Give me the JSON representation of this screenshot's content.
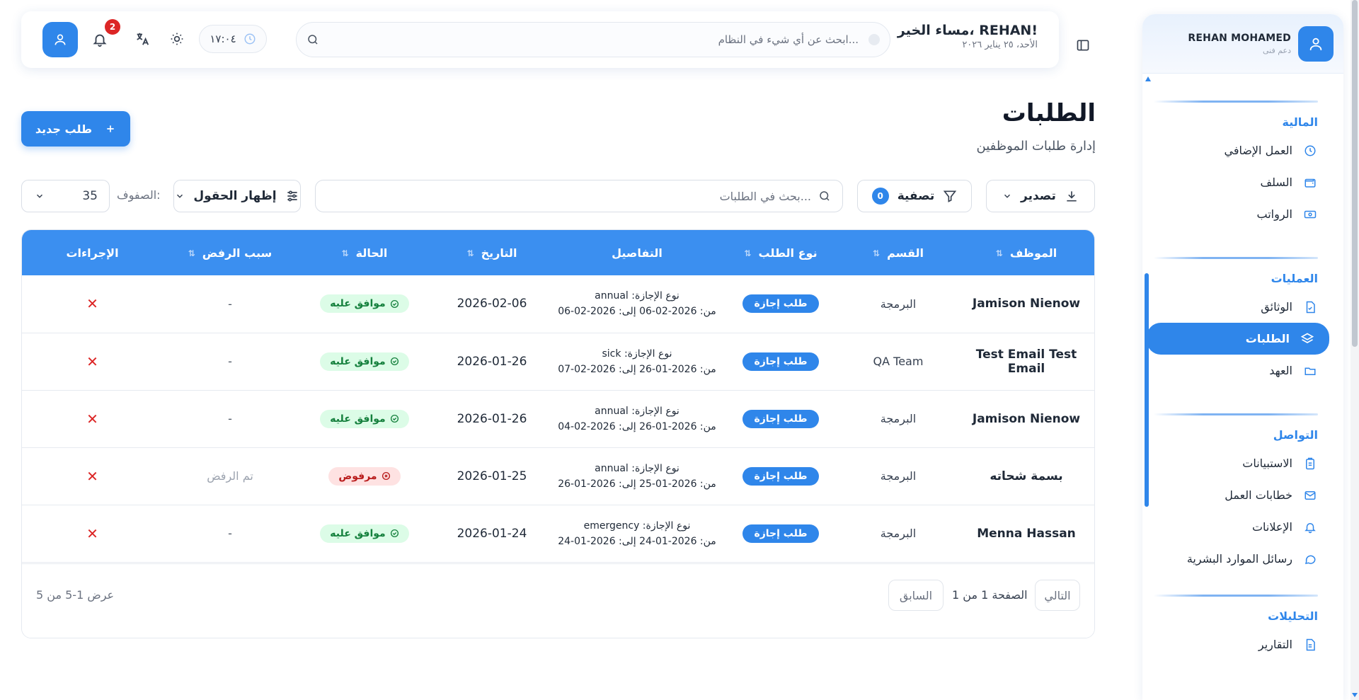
{
  "sidebar": {
    "user_name": "REHAN MOHAMED",
    "user_role": "دعم فنى",
    "sections": [
      {
        "title": "المالية",
        "items": [
          {
            "label": "العمل الإضافي",
            "icon": "clock-icon"
          },
          {
            "label": "السلف",
            "icon": "wallet-icon"
          },
          {
            "label": "الرواتب",
            "icon": "banknote-icon"
          }
        ]
      },
      {
        "title": "العمليات",
        "items": [
          {
            "label": "الوثائق",
            "icon": "file-check-icon"
          },
          {
            "label": "الطلبات",
            "icon": "layers-icon",
            "active": true
          },
          {
            "label": "العهد",
            "icon": "folder-open-icon"
          }
        ]
      },
      {
        "title": "التواصل",
        "items": [
          {
            "label": "الاستبيانات",
            "icon": "clipboard-icon"
          },
          {
            "label": "خطابات العمل",
            "icon": "mail-icon"
          },
          {
            "label": "الإعلانات",
            "icon": "bell-icon"
          },
          {
            "label": "رسائل الموارد البشرية",
            "icon": "message-circle-icon"
          }
        ]
      },
      {
        "title": "التحليلات",
        "items": [
          {
            "label": "التقارير",
            "icon": "file-text-icon"
          }
        ]
      }
    ]
  },
  "header": {
    "greeting": "مساء الخير، REHAN!",
    "date": "الأحد، ٢٥ يناير ٢٠٢٦",
    "search_placeholder": "ابحث عن أي شيء في النظام...",
    "time": "١٧:٠٤",
    "notification_count": "2"
  },
  "page": {
    "title": "الطلبات",
    "subtitle": "إدارة طلبات الموظفين",
    "new_button": "طلب جديد"
  },
  "toolbar": {
    "export_label": "تصدير",
    "filter_label": "تصفية",
    "filter_count": "0",
    "search_placeholder": "بحث في الطلبات...",
    "fields_label": "إظهار الحقول",
    "rows_label": "الصفوف:",
    "rows_value": "35"
  },
  "table": {
    "columns": [
      "الموظف",
      "القسم",
      "نوع الطلب",
      "التفاصيل",
      "التاريخ",
      "الحالة",
      "سبب الرفض",
      "الإجراءات"
    ],
    "rows": [
      {
        "employee": "Jamison Nienow",
        "department": "البرمجة",
        "type": "طلب إجازة",
        "detail_line1": "نوع الإجازة: annual",
        "detail_line2": "من: 2026-02-06 إلى: 2026-02-06",
        "date": "2026-02-06",
        "status": "موافق عليه",
        "status_kind": "ok",
        "reason": "-"
      },
      {
        "employee": "Test Email Test Email",
        "department": "QA Team",
        "type": "طلب إجازة",
        "detail_line1": "نوع الإجازة: sick",
        "detail_line2": "من: 2026-01-26 إلى: 2026-02-07",
        "date": "2026-01-26",
        "status": "موافق عليه",
        "status_kind": "ok",
        "reason": "-"
      },
      {
        "employee": "Jamison Nienow",
        "department": "البرمجة",
        "type": "طلب إجازة",
        "detail_line1": "نوع الإجازة: annual",
        "detail_line2": "من: 2026-01-26 إلى: 2026-02-04",
        "date": "2026-01-26",
        "status": "موافق عليه",
        "status_kind": "ok",
        "reason": "-"
      },
      {
        "employee": "بسمة شحاته",
        "department": "البرمجة",
        "type": "طلب إجازة",
        "detail_line1": "نوع الإجازة: annual",
        "detail_line2": "من: 2026-01-25 إلى: 2026-01-26",
        "date": "2026-01-25",
        "status": "مرفوض",
        "status_kind": "rej",
        "reason": "تم الرفض"
      },
      {
        "employee": "Menna Hassan",
        "department": "البرمجة",
        "type": "طلب إجازة",
        "detail_line1": "نوع الإجازة: emergency",
        "detail_line2": "من: 2026-01-24 إلى: 2026-01-24",
        "date": "2026-01-24",
        "status": "موافق عليه",
        "status_kind": "ok",
        "reason": "-"
      }
    ],
    "action_symbol": "✕"
  },
  "pagination": {
    "next": "التالي",
    "prev": "السابق",
    "page_info": "الصفحة 1 من 1",
    "showing": "عرض 1-5 من 5"
  },
  "colors": {
    "primary": "#2f86ea",
    "header_row": "#3b8ff0",
    "success_bg": "#dcfce7",
    "success_text": "#15803d",
    "danger_bg": "#fee2e2",
    "danger_text": "#b91c1c"
  }
}
